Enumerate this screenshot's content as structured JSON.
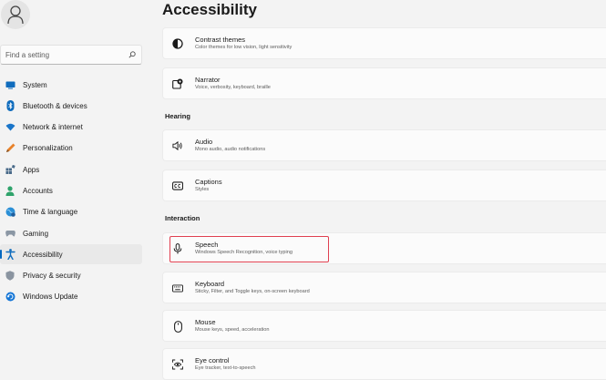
{
  "colors": {
    "accent": "#0067c0",
    "highlight": "#e04050",
    "background": "#f3f3f3",
    "card": "#fbfbfb"
  },
  "search": {
    "placeholder": "Find a setting",
    "icon": "search-icon"
  },
  "sidebar": {
    "items": [
      {
        "label": "System",
        "icon": "monitor-icon"
      },
      {
        "label": "Bluetooth & devices",
        "icon": "bluetooth-icon"
      },
      {
        "label": "Network & internet",
        "icon": "wifi-icon"
      },
      {
        "label": "Personalization",
        "icon": "pen-icon"
      },
      {
        "label": "Apps",
        "icon": "apps-icon"
      },
      {
        "label": "Accounts",
        "icon": "account-icon"
      },
      {
        "label": "Time & language",
        "icon": "globe-clock-icon"
      },
      {
        "label": "Gaming",
        "icon": "gamepad-icon"
      },
      {
        "label": "Accessibility",
        "icon": "accessibility-icon",
        "active": true
      },
      {
        "label": "Privacy & security",
        "icon": "shield-icon"
      },
      {
        "label": "Windows Update",
        "icon": "update-icon"
      }
    ]
  },
  "main": {
    "title": "Accessibility",
    "sections": {
      "hearing": "Hearing",
      "interaction": "Interaction"
    },
    "cards": [
      {
        "title": "Contrast themes",
        "subtitle": "Color themes for low vision, light sensitivity",
        "icon": "contrast-icon"
      },
      {
        "title": "Narrator",
        "subtitle": "Voice, verbosity, keyboard, braille",
        "icon": "narrator-icon"
      },
      {
        "title": "Audio",
        "subtitle": "Mono audio, audio notifications",
        "icon": "speaker-icon"
      },
      {
        "title": "Captions",
        "subtitle": "Styles",
        "icon": "captions-icon"
      },
      {
        "title": "Speech",
        "subtitle": "Windows Speech Recognition, voice typing",
        "icon": "microphone-icon",
        "highlighted": true
      },
      {
        "title": "Keyboard",
        "subtitle": "Sticky, Filter, and Toggle keys, on-screen keyboard",
        "icon": "keyboard-icon"
      },
      {
        "title": "Mouse",
        "subtitle": "Mouse keys, speed, acceleration",
        "icon": "mouse-icon"
      },
      {
        "title": "Eye control",
        "subtitle": "Eye tracker, text-to-speech",
        "icon": "eye-control-icon"
      }
    ]
  }
}
